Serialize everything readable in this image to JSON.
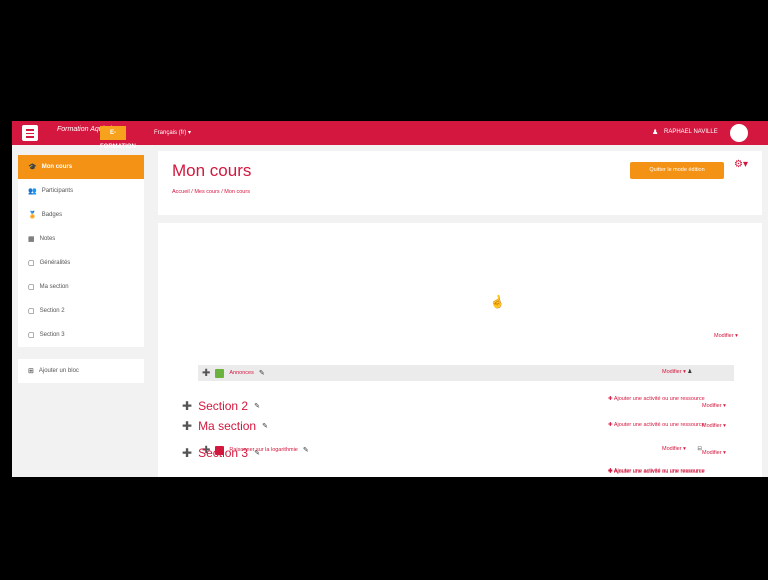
{
  "navbar": {
    "logo_text": "Formation Aquitaine",
    "logo2_text": "E-FORMATION",
    "language": "Français (fr) ▾",
    "username": "RAPHAEL NAVILLE"
  },
  "sidebar": {
    "items": [
      {
        "label": "Mon cours",
        "icon": "graduation-cap-icon",
        "glyph": "🎓"
      },
      {
        "label": "Participants",
        "icon": "users-icon",
        "glyph": "👥"
      },
      {
        "label": "Badges",
        "icon": "badge-icon",
        "glyph": "🏅"
      },
      {
        "label": "Notes",
        "icon": "grades-icon",
        "glyph": "▦"
      },
      {
        "label": "Généralités",
        "icon": "folder-icon",
        "glyph": "▢"
      },
      {
        "label": "Ma section",
        "icon": "folder-icon",
        "glyph": "▢"
      },
      {
        "label": "Section 2",
        "icon": "folder-icon",
        "glyph": "▢"
      },
      {
        "label": "Section 3",
        "icon": "folder-icon",
        "glyph": "▢"
      }
    ],
    "add_block": {
      "label": "Ajouter un bloc",
      "icon": "plus-square-icon",
      "glyph": "⊞"
    }
  },
  "header": {
    "title": "Mon cours",
    "breadcrumb": "Accueil  /  Mes cours  /  Mon cours",
    "edit_button": "Quitter le mode édition"
  },
  "sections": {
    "general": {
      "modifier": "Modifier ▾",
      "activity": "Annonces",
      "activity_modifier": "Modifier ▾",
      "add_activity": "✚ Ajouter une activité ou une ressource"
    },
    "section1": {
      "title": "Ma section",
      "modifier": "Modifier ▾",
      "activity": "Raisonner sur la logarithmie",
      "activity_modifier": "Modifier ▾",
      "add_activity": "✚ Ajouter une activité ou une ressource"
    },
    "section2": {
      "title": "Section 2",
      "modifier": "Modifier ▾",
      "add_activity": "✚ Ajouter une activité ou une ressource"
    },
    "section3": {
      "title": "Section 3",
      "modifier": "Modifier ▾",
      "add_activity": "✚ Ajouter une activité ou une ressource"
    }
  },
  "colors": {
    "brand": "#d3173e",
    "accent": "#f39215"
  }
}
